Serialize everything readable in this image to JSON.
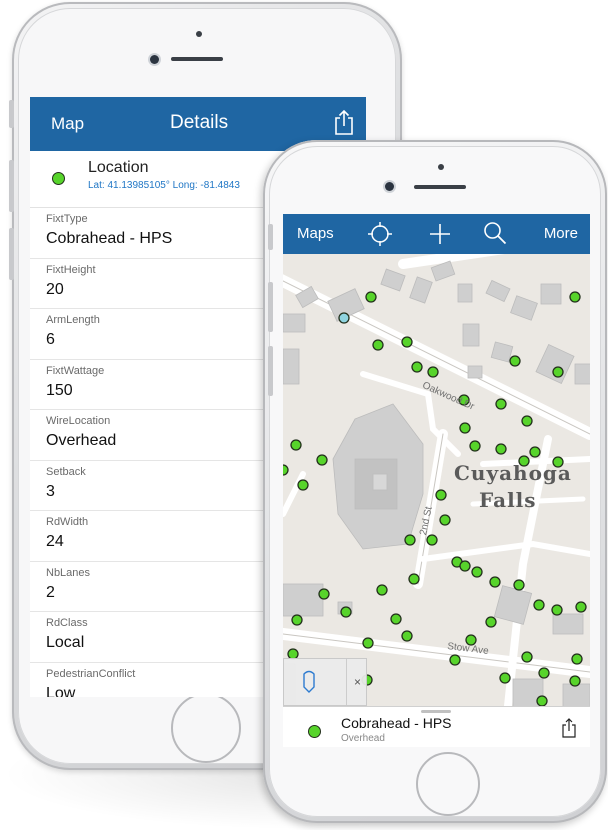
{
  "details_screen": {
    "nav": {
      "back_label": "Map",
      "title": "Details"
    },
    "location": {
      "title": "Location",
      "coords": "Lat: 41.13985105° Long: -81.4843"
    },
    "fields": [
      {
        "label": "FixtType",
        "value": "Cobrahead - HPS"
      },
      {
        "label": "FixtHeight",
        "value": "20"
      },
      {
        "label": "ArmLength",
        "value": "6"
      },
      {
        "label": "FixtWattage",
        "value": "150"
      },
      {
        "label": "WireLocation",
        "value": "Overhead"
      },
      {
        "label": "Setback",
        "value": "3"
      },
      {
        "label": "RdWidth",
        "value": "24"
      },
      {
        "label": "NbLanes",
        "value": "2"
      },
      {
        "label": "RdClass",
        "value": "Local"
      },
      {
        "label": "PedestrianConflict",
        "value": "Low"
      }
    ]
  },
  "map_screen": {
    "nav": {
      "maps_label": "Maps",
      "more_label": "More",
      "icons": [
        "locate-icon",
        "plus-icon",
        "search-icon"
      ]
    },
    "map_labels": {
      "place_line1": "Cuyahoga",
      "place_line2": "Falls",
      "street_oakwood": "Oakwood Dr",
      "street_2nd": "2nd St",
      "street_stow": "Stow Ave"
    },
    "toolbar": {
      "close_glyph": "×",
      "icons": [
        "pin-icon"
      ]
    },
    "feature_card": {
      "title": "Cobrahead - HPS",
      "subtitle": "Overhead",
      "icons": [
        "share-icon"
      ]
    }
  },
  "colors": {
    "nav_blue": "#1f66a3",
    "point_green": "#57d42b",
    "link_blue": "#1f76c5",
    "map_bg": "#ebe8e3",
    "building": "#cfcfcf"
  }
}
